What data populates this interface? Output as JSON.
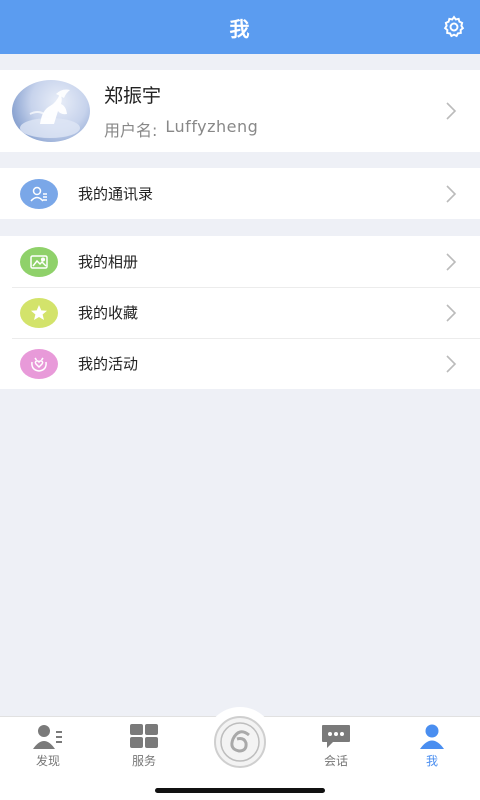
{
  "header": {
    "title": "我"
  },
  "profile": {
    "name": "郑振宇",
    "username_label": "用户名:",
    "username": "Luffyzheng"
  },
  "menu_sections": [
    {
      "items": [
        {
          "label": "我的通讯录",
          "icon": "contacts-icon",
          "color": "#7aa7e8"
        }
      ]
    },
    {
      "items": [
        {
          "label": "我的相册",
          "icon": "photo-album-icon",
          "color": "#8fd16a"
        },
        {
          "label": "我的收藏",
          "icon": "star-icon",
          "color": "#d3e36b"
        },
        {
          "label": "我的活动",
          "icon": "activity-icon",
          "color": "#e89ad9"
        }
      ]
    }
  ],
  "tabbar": {
    "tabs": [
      {
        "label": "发现",
        "icon": "discover-icon"
      },
      {
        "label": "服务",
        "icon": "services-grid-icon"
      },
      {
        "label": "",
        "icon": "center-logo-icon"
      },
      {
        "label": "会话",
        "icon": "chat-icon"
      },
      {
        "label": "我",
        "icon": "profile-icon",
        "active": true
      }
    ]
  },
  "colors": {
    "header_bg": "#5b9cf0",
    "active_tab": "#4a8ef0",
    "inactive_tab": "#777777",
    "page_bg": "#eef0f6"
  }
}
